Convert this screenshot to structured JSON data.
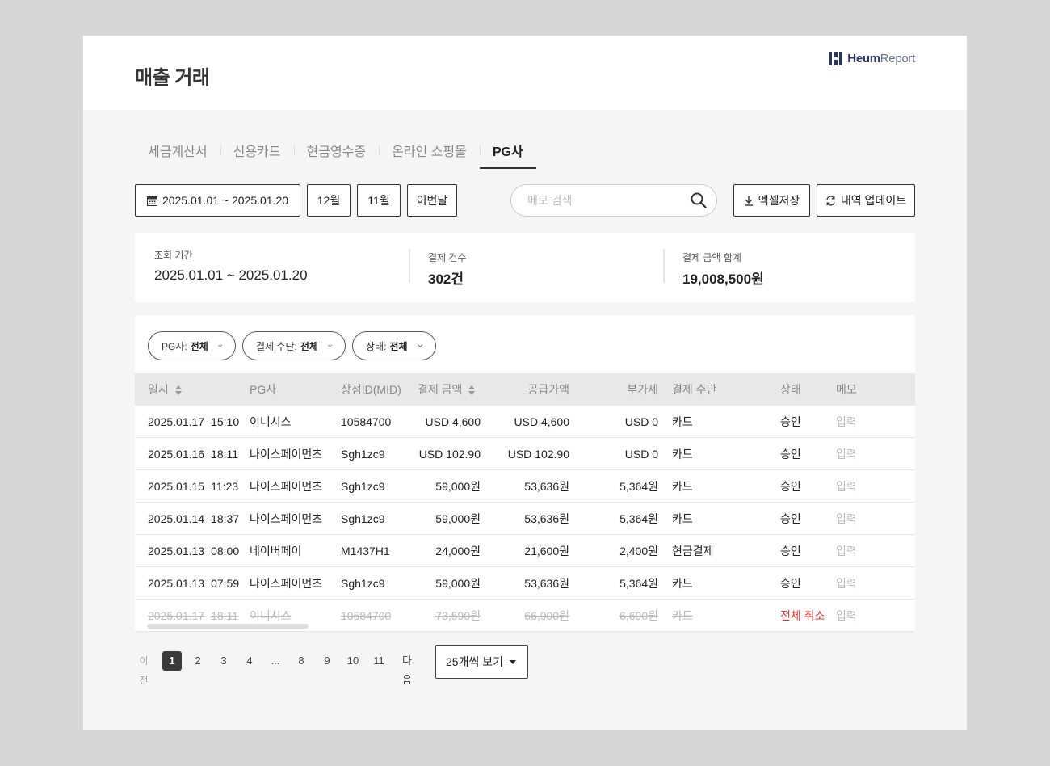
{
  "header": {
    "title": "매출 거래",
    "logo_bold": "Heum",
    "logo_light": "Report"
  },
  "tabs": [
    {
      "label": "세금계산서",
      "active": false
    },
    {
      "label": "신용카드",
      "active": false
    },
    {
      "label": "현금영수증",
      "active": false
    },
    {
      "label": "온라인 쇼핑몰",
      "active": false
    },
    {
      "label": "PG사",
      "active": true
    }
  ],
  "toolbar": {
    "date_range": "2025.01.01 ~ 2025.01.20",
    "month_buttons": [
      "12월",
      "11월",
      "이번달"
    ],
    "search_placeholder": "메모 검색",
    "excel_label": "엑셀저장",
    "update_label": "내역 업데이트"
  },
  "summary": {
    "period_label": "조회 기간",
    "period_value": "2025.01.01 ~ 2025.01.20",
    "count_label": "결제 건수",
    "count_value": "302건",
    "total_label": "결제 금액 합계",
    "total_value": "19,008,500원"
  },
  "filters": [
    {
      "label": "PG사: ",
      "value": "전체"
    },
    {
      "label": "결제 수단: ",
      "value": "전체"
    },
    {
      "label": "상태: ",
      "value": "전체"
    }
  ],
  "table": {
    "headers": {
      "datetime": "일시",
      "pg": "PG사",
      "mid": "상점ID(MID)",
      "amount": "결제 금액",
      "supply": "공급가액",
      "vat": "부가세",
      "method": "결제 수단",
      "status": "상태",
      "memo": "메모"
    },
    "rows": [
      {
        "date": "2025.01.17",
        "time": "15:10",
        "pg": "이니시스",
        "mid": "10584700",
        "amount": "USD 4,600",
        "supply": "USD 4,600",
        "vat": "USD 0",
        "method": "카드",
        "status": "승인",
        "memo": "입력",
        "cancelled": false
      },
      {
        "date": "2025.01.16",
        "time": "18:11",
        "pg": "나이스페이먼츠",
        "mid": "Sgh1zc9",
        "amount": "USD 102.90",
        "supply": "USD 102.90",
        "vat": "USD 0",
        "method": "카드",
        "status": "승인",
        "memo": "입력",
        "cancelled": false
      },
      {
        "date": "2025.01.15",
        "time": "11:23",
        "pg": "나이스페이먼츠",
        "mid": "Sgh1zc9",
        "amount": "59,000원",
        "supply": "53,636원",
        "vat": "5,364원",
        "method": "카드",
        "status": "승인",
        "memo": "입력",
        "cancelled": false
      },
      {
        "date": "2025.01.14",
        "time": "18:37",
        "pg": "나이스페이먼츠",
        "mid": "Sgh1zc9",
        "amount": "59,000원",
        "supply": "53,636원",
        "vat": "5,364원",
        "method": "카드",
        "status": "승인",
        "memo": "입력",
        "cancelled": false
      },
      {
        "date": "2025.01.13",
        "time": "08:00",
        "pg": "네이버페이",
        "mid": "M1437H1",
        "amount": "24,000원",
        "supply": "21,600원",
        "vat": "2,400원",
        "method": "현금결제",
        "status": "승인",
        "memo": "입력",
        "cancelled": false
      },
      {
        "date": "2025.01.13",
        "time": "07:59",
        "pg": "나이스페이먼츠",
        "mid": "Sgh1zc9",
        "amount": "59,000원",
        "supply": "53,636원",
        "vat": "5,364원",
        "method": "카드",
        "status": "승인",
        "memo": "입력",
        "cancelled": false
      },
      {
        "date": "2025.01.17",
        "time": "18:11",
        "pg": "이니시스",
        "mid": "10584700",
        "amount": "73,590원",
        "supply": "66,900원",
        "vat": "6,690원",
        "method": "카드",
        "status": "전체 취소",
        "memo": "입력",
        "cancelled": true
      }
    ]
  },
  "pagination": {
    "prev": "이전",
    "pages": [
      "1",
      "2",
      "3",
      "4",
      "...",
      "8",
      "9",
      "10",
      "11"
    ],
    "current": "1",
    "next": "다음",
    "per_page": "25개씩 보기"
  },
  "colors": {
    "cancel_status": "#e53935",
    "brand": "#2a3560"
  }
}
